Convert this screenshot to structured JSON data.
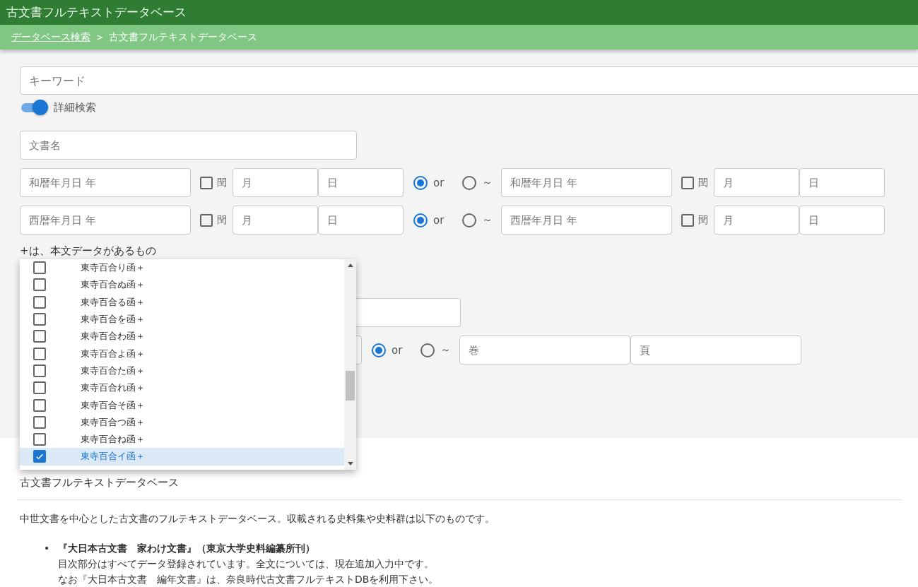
{
  "header": {
    "title": "古文書フルテキストデータベース"
  },
  "breadcrumb": {
    "items": [
      {
        "label": "データベース検索",
        "link": true
      },
      {
        "label": "古文書フルテキストデータベース",
        "link": false
      }
    ],
    "separator": ">"
  },
  "search": {
    "keyword": {
      "placeholder": "キーワード"
    },
    "advanced_toggle": {
      "label": "詳細検索",
      "on": true
    },
    "document_name": {
      "placeholder": "文書名"
    },
    "date_rows": [
      {
        "from": {
          "year_placeholder": "和暦年月日 年",
          "leap_label": "閏",
          "leap_checked": false,
          "month_placeholder": "月",
          "day_placeholder": "日"
        },
        "modes": [
          {
            "label": "or",
            "selected": true
          },
          {
            "label": "～",
            "selected": false
          }
        ],
        "to": {
          "year_placeholder": "和暦年月日 年",
          "leap_label": "閏",
          "leap_checked": false,
          "month_placeholder": "月",
          "day_placeholder": "日"
        }
      },
      {
        "from": {
          "year_placeholder": "西暦年月日 年",
          "leap_label": "閏",
          "leap_checked": false,
          "month_placeholder": "月",
          "day_placeholder": "日"
        },
        "modes": [
          {
            "label": "or",
            "selected": true
          },
          {
            "label": "～",
            "selected": false
          }
        ],
        "to": {
          "year_placeholder": "西暦年月日 年",
          "leap_label": "閏",
          "leap_checked": false,
          "month_placeholder": "月",
          "day_placeholder": "日"
        }
      }
    ],
    "note": "+は、本文データがあるもの",
    "volume_row": {
      "modes": [
        {
          "label": "or",
          "selected": true
        },
        {
          "label": "～",
          "selected": false
        }
      ],
      "volume": {
        "placeholder": "巻"
      },
      "page": {
        "placeholder": "頁"
      }
    }
  },
  "dropdown": {
    "items": [
      {
        "label": "東寺百合り函＋",
        "checked": false
      },
      {
        "label": "東寺百合ぬ函＋",
        "checked": false
      },
      {
        "label": "東寺百合る函＋",
        "checked": false
      },
      {
        "label": "東寺百合を函＋",
        "checked": false
      },
      {
        "label": "東寺百合わ函＋",
        "checked": false
      },
      {
        "label": "東寺百合よ函＋",
        "checked": false
      },
      {
        "label": "東寺百合た函＋",
        "checked": false
      },
      {
        "label": "東寺百合れ函＋",
        "checked": false
      },
      {
        "label": "東寺百合そ函＋",
        "checked": false
      },
      {
        "label": "東寺百合つ函＋",
        "checked": false
      },
      {
        "label": "東寺百合ね函＋",
        "checked": false
      },
      {
        "label": "東寺百合イ函＋",
        "checked": true
      }
    ]
  },
  "info": {
    "heading": "古文書フルテキストデータベース",
    "intro": "中世文書を中心とした古文書のフルテキストデータベース。収載される史料集や史料群は以下のものです。",
    "sources": [
      {
        "marker": "•",
        "title": "『大日本古文書　家わけ文書』（東京大学史料編纂所刊）",
        "lines": [
          "目次部分はすべてデータ登録されています。全文については、現在追加入力中です。",
          "なお『大日本古文書　編年文書』は、奈良時代古文書フルテキストDBを利用下さい。"
        ]
      }
    ]
  }
}
